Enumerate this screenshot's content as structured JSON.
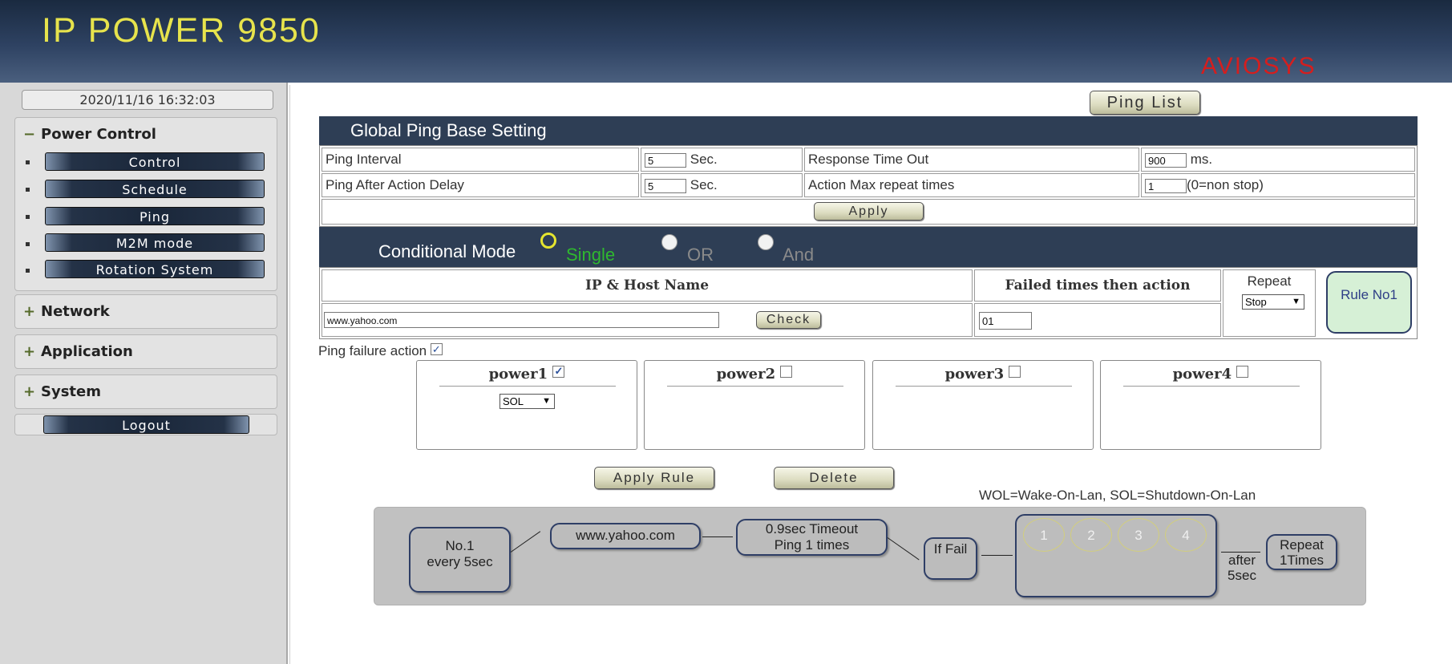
{
  "header": {
    "title": "IP POWER 9850",
    "brand": "AVIOSYS"
  },
  "sidebar": {
    "datetime": "2020/11/16 16:32:03",
    "power_control": {
      "label": "Power Control",
      "sign": "−",
      "items": [
        "Control",
        "Schedule",
        "Ping",
        "M2M mode",
        "Rotation System"
      ]
    },
    "network": {
      "label": "Network",
      "sign": "+"
    },
    "application": {
      "label": "Application",
      "sign": "+"
    },
    "system": {
      "label": "System",
      "sign": "+"
    },
    "logout": "Logout"
  },
  "ping_list_button": "Ping List",
  "global": {
    "title": "Global Ping Base Setting",
    "ping_interval_label": "Ping Interval",
    "ping_interval_value": "5",
    "ping_interval_unit": "Sec.",
    "response_timeout_label": "Response Time Out",
    "response_timeout_value": "900",
    "response_timeout_unit": "ms.",
    "after_action_delay_label": "Ping After Action Delay",
    "after_action_delay_value": "5",
    "after_action_delay_unit": "Sec.",
    "max_repeat_label": "Action Max repeat times",
    "max_repeat_value": "1",
    "max_repeat_note": "(0=non stop)",
    "apply": "Apply"
  },
  "conditional": {
    "title": "Conditional Mode",
    "options": [
      "Single",
      "OR",
      "And"
    ],
    "selected": "Single",
    "selected_color": "#2fb82f",
    "ip_header": "IP & Host Name",
    "failed_header": "Failed times then action",
    "repeat_header": "Repeat",
    "ip_value": "www.yahoo.com",
    "check": "Check",
    "failed_value": "01",
    "repeat_value": "Stop",
    "rule_label": "Rule No1"
  },
  "failure": {
    "label": "Ping failure action",
    "checked": "✓",
    "powers": [
      {
        "name": "power1",
        "checked": "✓",
        "select": "SOL"
      },
      {
        "name": "power2",
        "checked": ""
      },
      {
        "name": "power3",
        "checked": ""
      },
      {
        "name": "power4",
        "checked": ""
      }
    ]
  },
  "actions": {
    "apply_rule": "Apply Rule",
    "delete": "Delete"
  },
  "legend_note": "WOL=Wake-On-Lan, SOL=Shutdown-On-Lan",
  "diagram": {
    "rule_line1": "No.1",
    "rule_line2": "every 5sec",
    "host": "www.yahoo.com",
    "timeout_line1": "0.9sec Timeout",
    "timeout_line2": "Ping 1 times",
    "if_fail": "If Fail",
    "outlets": [
      "1",
      "2",
      "3",
      "4"
    ],
    "after_line1": "after",
    "after_line2": "5sec",
    "repeat_line1": "Repeat",
    "repeat_line2": "1Times"
  }
}
